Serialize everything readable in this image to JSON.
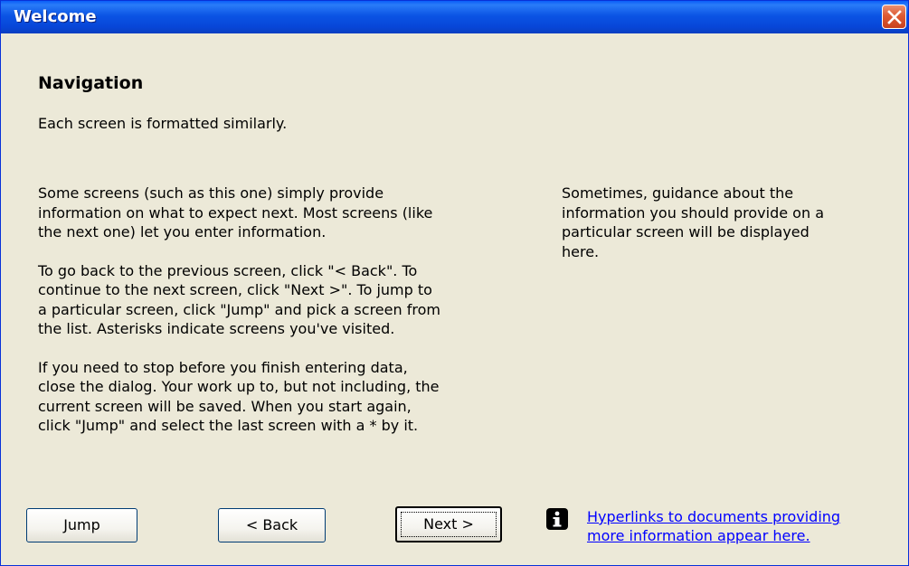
{
  "window": {
    "title": "Welcome"
  },
  "heading": "Navigation",
  "intro": "Each screen is formatted similarly.",
  "main_paragraphs": [
    [
      "Some screens (such as this one) simply provide",
      "information on what to expect next. Most screens (like",
      "the next one) let you enter information."
    ],
    [
      "To go back to the previous screen, click \"< Back\". To",
      "continue to the next screen, click \"Next >\". To jump to",
      "a particular screen, click \"Jump\" and pick a screen from",
      "the list. Asterisks indicate screens you've visited."
    ],
    [
      "If you need to stop before you finish entering data,",
      "close the dialog. Your work up to, but not including, the",
      "current screen will be saved.  When you start again,",
      "click \"Jump\" and select the last screen with a * by it."
    ]
  ],
  "guidance": [
    "Sometimes, guidance about the",
    "information you should provide on a",
    "particular screen will be displayed",
    "here."
  ],
  "buttons": {
    "jump": "Jump",
    "back": "< Back",
    "next": "Next >"
  },
  "link": [
    "Hyperlinks to documents providing",
    "more information appear here."
  ],
  "icons": {
    "info": "info-icon",
    "close": "close-icon"
  },
  "colors": {
    "title_bar": "#0b54e4",
    "background": "#ece9d8",
    "link": "#0000ff",
    "close": "#df5a33"
  }
}
